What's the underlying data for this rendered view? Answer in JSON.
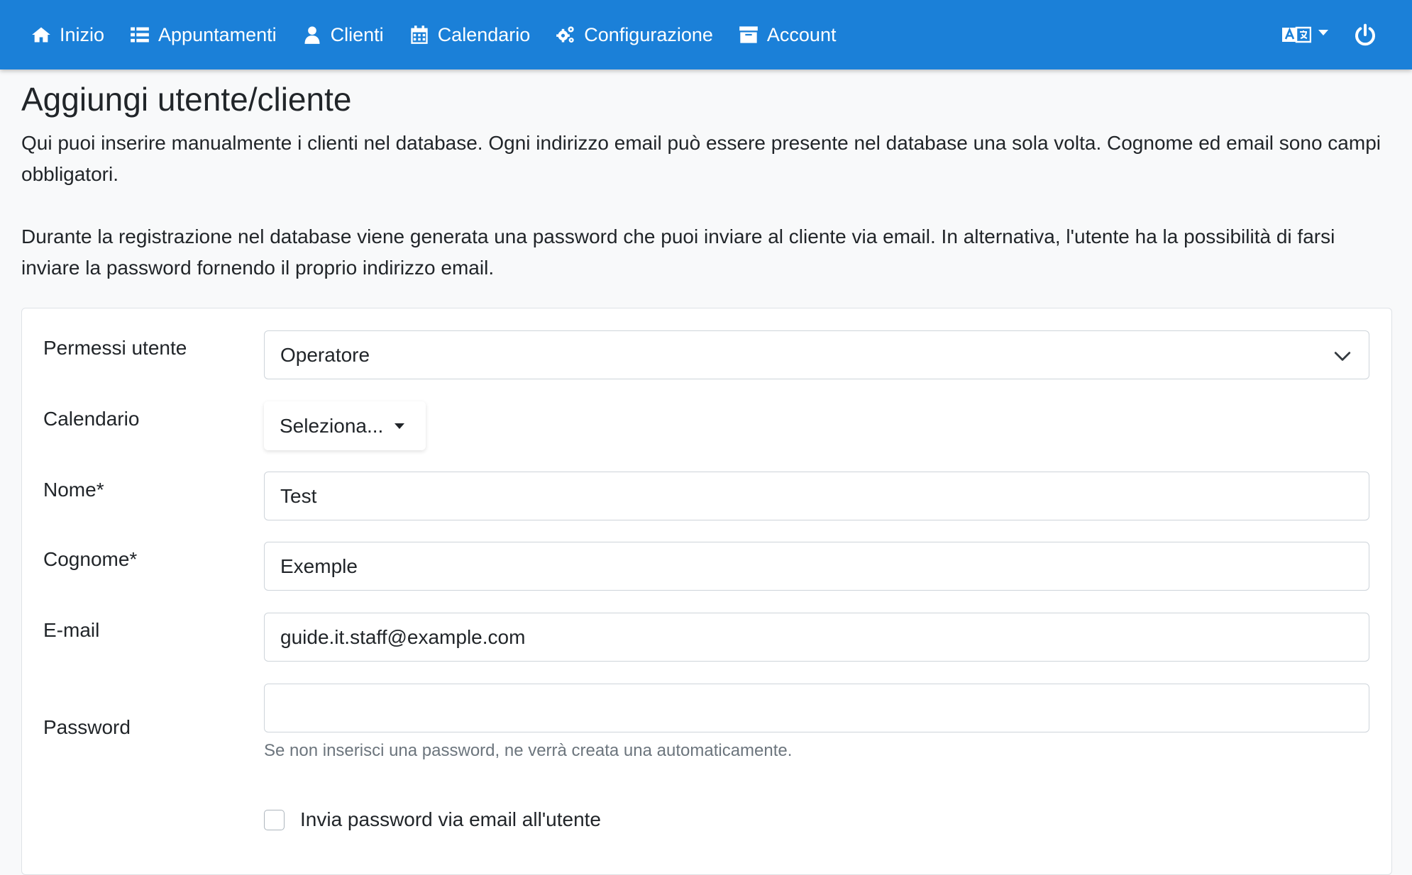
{
  "navbar": {
    "items": [
      {
        "label": "Inizio",
        "icon": "home-icon"
      },
      {
        "label": "Appuntamenti",
        "icon": "list-icon"
      },
      {
        "label": "Clienti",
        "icon": "user-icon"
      },
      {
        "label": "Calendario",
        "icon": "calendar-icon"
      },
      {
        "label": "Configurazione",
        "icon": "gears-icon"
      },
      {
        "label": "Account",
        "icon": "archive-icon"
      }
    ],
    "language_icon": "language-icon",
    "logout_icon": "power-icon",
    "background": "#1b80d8"
  },
  "page": {
    "title": "Aggiungi utente/cliente",
    "intro_1": "Qui puoi inserire manualmente i clienti nel database. Ogni indirizzo email può essere presente nel database una sola volta. Cognome ed email sono campi obbligatori.",
    "intro_2": "Durante la registrazione nel database viene generata una password che puoi inviare al cliente via email. In alternativa, l'utente ha la possibilità di farsi inviare la password fornendo il proprio indirizzo email."
  },
  "form": {
    "permissions": {
      "label": "Permessi utente",
      "value": "Operatore"
    },
    "calendar": {
      "label": "Calendario",
      "value": "Seleziona..."
    },
    "first_name": {
      "label": "Nome*",
      "value": "Test"
    },
    "last_name": {
      "label": "Cognome*",
      "value": "Exemple"
    },
    "email": {
      "label": "E-mail",
      "value": "guide.it.staff@example.com"
    },
    "password": {
      "label": "Password",
      "value": "",
      "help": "Se non inserisci una password, ne verrà creata una automaticamente."
    },
    "send_password": {
      "label": "Invia password via email all'utente",
      "checked": false
    }
  }
}
